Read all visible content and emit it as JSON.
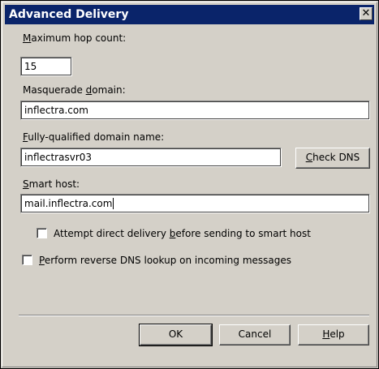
{
  "window": {
    "title": "Advanced Delivery",
    "close_glyph": "✕"
  },
  "fields": {
    "max_hop": {
      "label_pre": "",
      "label_key": "M",
      "label_post": "aximum hop count:",
      "value": "15"
    },
    "masquerade": {
      "label_pre": "Masquerade ",
      "label_key": "d",
      "label_post": "omain:",
      "value": "inflectra.com"
    },
    "fqdn": {
      "label_pre": "",
      "label_key": "F",
      "label_post": "ully-qualified domain name:",
      "value": "inflectrasvr03"
    },
    "smart_host": {
      "label_pre": "",
      "label_key": "S",
      "label_post": "mart host:",
      "value": "mail.inflectra.com"
    }
  },
  "check_dns": {
    "label_pre": "",
    "label_key": "C",
    "label_post": "heck DNS"
  },
  "options": {
    "direct_delivery": {
      "checked": false,
      "label_pre": "Attempt direct delivery ",
      "label_key": "b",
      "label_post": "efore sending to smart host"
    },
    "reverse_dns": {
      "checked": false,
      "label_pre": "",
      "label_key": "P",
      "label_post": "erform reverse DNS lookup on incoming messages"
    }
  },
  "buttons": {
    "ok": "OK",
    "cancel": "Cancel",
    "help": {
      "label_pre": "",
      "label_key": "H",
      "label_post": "elp"
    }
  }
}
